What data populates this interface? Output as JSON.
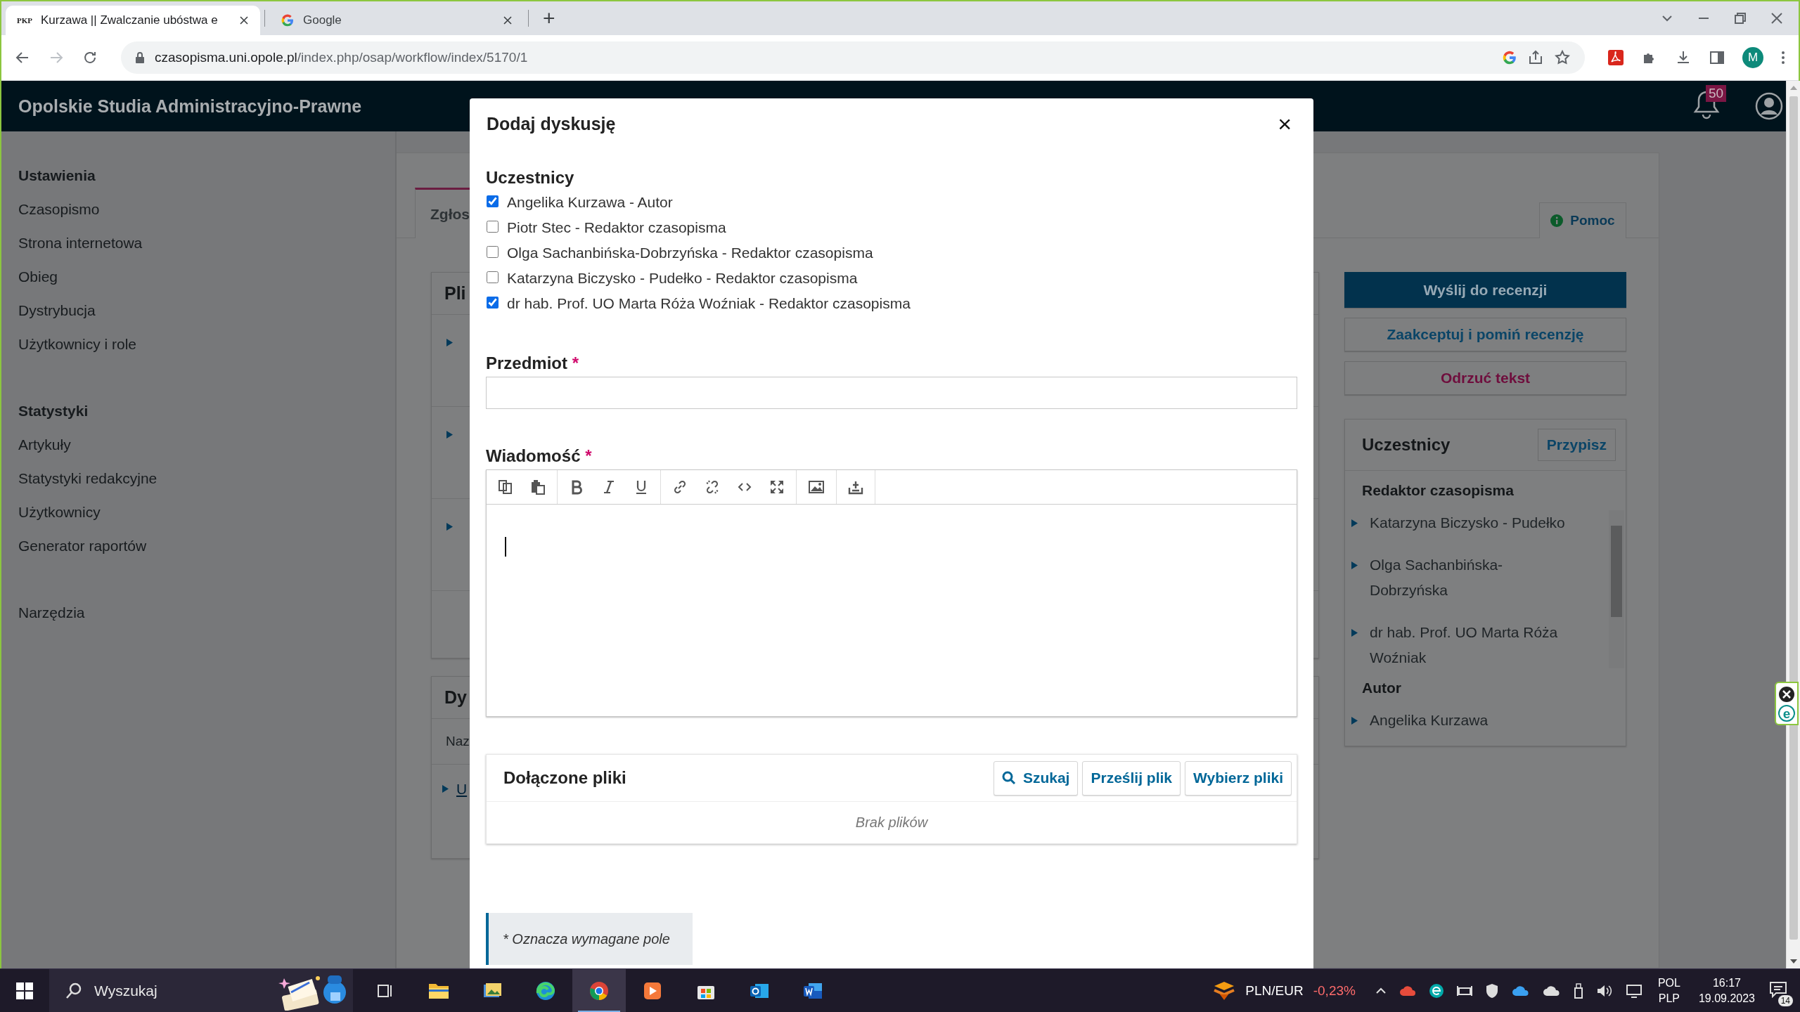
{
  "browser": {
    "tabs": [
      {
        "favicon": "PKP",
        "title": "Kurzawa || Zwalczanie ubóstwa e",
        "selected": true
      },
      {
        "title": "Google",
        "selected": false
      }
    ],
    "new_tab": "+",
    "address": {
      "host": "czasopisma.uni.opole.pl",
      "path": "/index.php/osap/workflow/index/5170/1"
    },
    "profile": "M"
  },
  "header": {
    "title": "Opolskie Studia Administracyjno-Prawne",
    "notifications": "50"
  },
  "sidebar": {
    "sections": [
      {
        "heading": "Ustawienia",
        "items": [
          "Czasopismo",
          "Strona internetowa",
          "Obieg",
          "Dystrybucja",
          "Użytkownicy i role"
        ]
      },
      {
        "heading": "Statystyki",
        "items": [
          "Artykuły",
          "Statystyki redakcyjne",
          "Użytkownicy",
          "Generator raportów"
        ]
      },
      {
        "items": [
          "Narzędzia"
        ]
      }
    ]
  },
  "workflow": {
    "tabs": [
      {
        "label": "Zgłos",
        "selected": true
      }
    ],
    "help": "Pomoc",
    "cards": [
      {
        "title": "Pli",
        "rows": [
          {
            "expanded": false
          },
          {
            "expanded": false
          },
          {
            "expanded": false
          }
        ]
      },
      {
        "title": "Dy",
        "column_1": "Naz",
        "rows": [
          {
            "expanded": false,
            "link": "U"
          }
        ]
      }
    ],
    "actions": [
      {
        "label": "Wyślij do recenzji",
        "kind": "primary"
      },
      {
        "label": "Zaakceptuj i pomiń recenzję",
        "kind": "default"
      },
      {
        "label": "Odrzuć tekst",
        "kind": "danger"
      }
    ],
    "participants": {
      "title": "Uczestnicy",
      "button": "Przypisz",
      "groups": [
        {
          "role": "Redaktor czasopisma",
          "members": [
            {
              "name": "Katarzyna Biczysko - Pudełko",
              "expanded": false
            },
            {
              "name": "Olga Sachanbińska-Dobrzyńska",
              "expanded": false
            },
            {
              "name": "dr hab. Prof. UO Marta Róża Woźniak",
              "expanded": false
            }
          ]
        },
        {
          "role": "Autor",
          "members": [
            {
              "name": "Angelika Kurzawa",
              "expanded": false
            }
          ]
        }
      ]
    }
  },
  "dialog": {
    "title": "Dodaj dyskusję",
    "close": "×",
    "participants_label": "Uczestnicy",
    "participants": [
      {
        "label": "Angelika Kurzawa - Autor",
        "checked": true
      },
      {
        "label": "Piotr Stec - Redaktor czasopisma",
        "checked": false
      },
      {
        "label": "Olga Sachanbińska-Dobrzyńska - Redaktor czasopisma",
        "checked": false
      },
      {
        "label": "Katarzyna Biczysko - Pudełko - Redaktor czasopisma",
        "checked": false
      },
      {
        "label": "dr hab. Prof. UO Marta Róża Woźniak - Redaktor czasopisma",
        "checked": true
      }
    ],
    "subject": {
      "label": "Przedmiot",
      "required_mark": "*"
    },
    "message": {
      "label": "Wiadomość",
      "required_mark": "*"
    },
    "attachments": {
      "title": "Dołączone pliki",
      "buttons": [
        {
          "label": "Szukaj",
          "kind": "search"
        },
        {
          "label": "Prześlij plik",
          "kind": "plain"
        },
        {
          "label": "Wybierz pliki",
          "kind": "plain"
        }
      ],
      "empty": "Brak plików"
    },
    "note": "* Oznacza wymagane pole"
  },
  "side_widget": {
    "logo": "e"
  },
  "taskbar": {
    "search": "Wyszukaj",
    "apps": [
      {
        "kind": "taskview",
        "selected": false
      },
      {
        "kind": "folder",
        "selected": false
      },
      {
        "kind": "photos",
        "selected": false
      },
      {
        "kind": "edge",
        "selected": false
      },
      {
        "kind": "chrome",
        "selected": true
      },
      {
        "kind": "player",
        "selected": false
      },
      {
        "kind": "store",
        "selected": false
      },
      {
        "kind": "mail",
        "selected": false
      },
      {
        "kind": "word",
        "selected": false
      }
    ],
    "ticker": {
      "label": "PLN/EUR",
      "change": "-0,23%"
    },
    "language": "POL",
    "layout": "PLP",
    "time": "16:17",
    "date": "19.09.2023",
    "notifications": "14"
  }
}
